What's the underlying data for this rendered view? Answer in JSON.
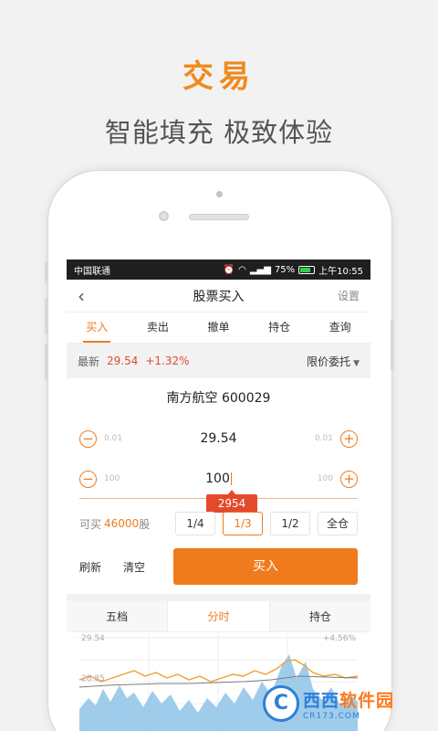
{
  "promo": {
    "title": "交易",
    "subtitle": "智能填充 极致体验"
  },
  "status_bar": {
    "carrier": "中国联通",
    "battery": "75%",
    "time": "上午10:55"
  },
  "nav": {
    "title": "股票买入",
    "settings": "设置"
  },
  "tabs": [
    {
      "label": "买入",
      "active": true
    },
    {
      "label": "卖出",
      "active": false
    },
    {
      "label": "撤单",
      "active": false
    },
    {
      "label": "持仓",
      "active": false
    },
    {
      "label": "查询",
      "active": false
    }
  ],
  "quote": {
    "label": "最新",
    "price": "29.54",
    "change": "+1.32%",
    "order_type": "限价委托"
  },
  "stock": {
    "name_code": "南方航空 600029"
  },
  "price_field": {
    "value": "29.54",
    "step_left": "0.01",
    "step_right": "0.01"
  },
  "qty_field": {
    "value": "100",
    "step_left": "100",
    "step_right": "100"
  },
  "amount_bubble": "2954",
  "available": {
    "prefix": "可买",
    "amount": "46000",
    "unit": "股"
  },
  "ratios": [
    {
      "label": "1/4",
      "active": false
    },
    {
      "label": "1/3",
      "active": true
    },
    {
      "label": "1/2",
      "active": false
    },
    {
      "label": "全仓",
      "active": false
    }
  ],
  "actions": {
    "refresh": "刷新",
    "clear": "清空",
    "buy": "买入"
  },
  "chart_tabs": [
    {
      "label": "五档",
      "active": false
    },
    {
      "label": "分时",
      "active": true
    },
    {
      "label": "持仓",
      "active": false
    }
  ],
  "chart": {
    "y_top_label": "29.54",
    "y_mid_label": "28.85",
    "pct_top_label": "+4.56%",
    "line_color": "#f0a030",
    "area_color": "#8ec3e8"
  },
  "watermark": {
    "logo_letter": "C",
    "main_a": "西西",
    "main_b": "软件园",
    "domain": "CR173.COM"
  },
  "colors": {
    "accent": "#f07b1c",
    "up": "#e5492b"
  }
}
